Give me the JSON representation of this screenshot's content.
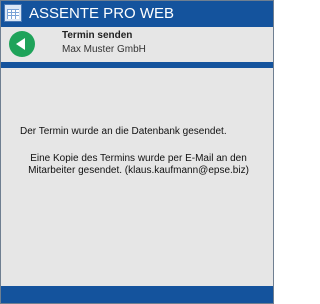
{
  "app": {
    "title": "ASSENTE PRO WEB",
    "logo_icon": "app-logo-icon"
  },
  "header": {
    "back_icon": "back-arrow-icon",
    "title": "Termin senden",
    "subtitle": "Max Muster GmbH"
  },
  "message": {
    "line_1": "Der Termin wurde an die Datenbank gesendet.",
    "line_2": "Eine Kopie des Termins wurde per E-Mail an den Mitarbeiter gesendet. (klaus.kaufmann@epse.biz)"
  },
  "colors": {
    "brand_blue": "#14539d",
    "back_green": "#1fa35a",
    "panel_gray": "#e6e6e6"
  }
}
